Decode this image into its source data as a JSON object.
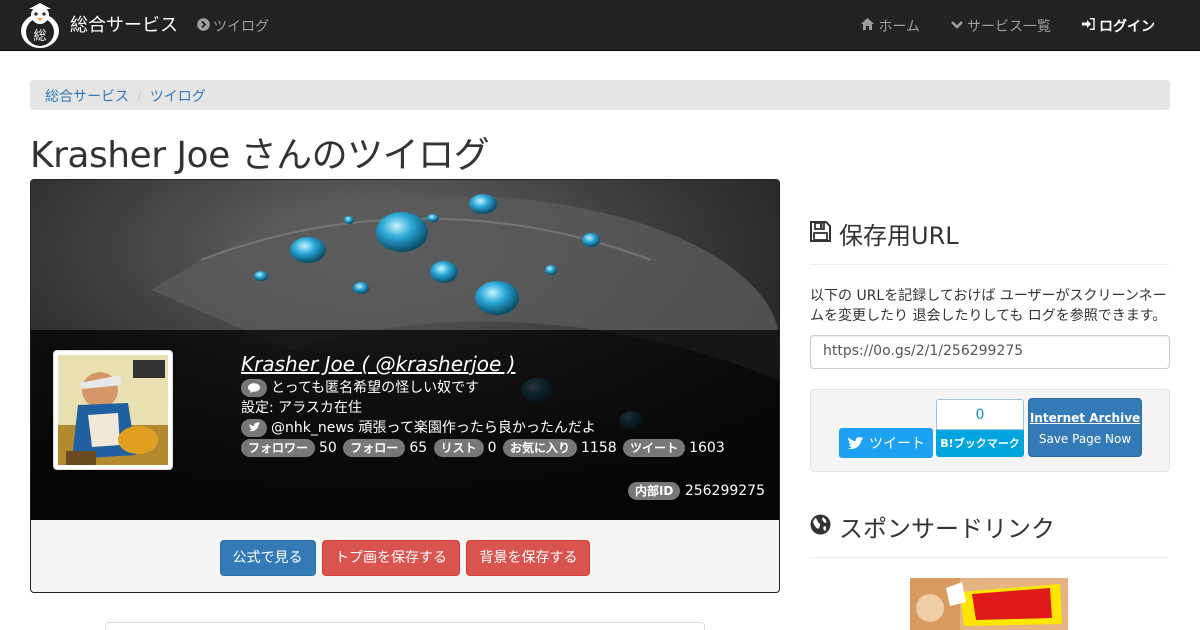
{
  "navbar": {
    "brand": "総合サービス",
    "brand_logo_glyph": "総",
    "section_link": "ツイログ",
    "items": [
      {
        "label": "ホーム",
        "icon": "home-icon"
      },
      {
        "label": "サービス一覧",
        "icon": "chevron-down-icon"
      },
      {
        "label": "ログイン",
        "icon": "sign-in-icon"
      }
    ]
  },
  "breadcrumb": [
    "総合サービス",
    "ツイログ"
  ],
  "page_title": "Krasher Joe さんのツイログ",
  "profile": {
    "name_line": "Krasher Joe ( @krasherjoe )",
    "bio": "とっても匿名希望の怪しい奴です",
    "location": "設定: アラスカ在住",
    "latest_tweet": "@nhk_news 頑張って楽園作ったら良かったんだよ",
    "stats": [
      {
        "label": "フォロワー",
        "value": "50"
      },
      {
        "label": "フォロー",
        "value": "65"
      },
      {
        "label": "リスト",
        "value": "0"
      },
      {
        "label": "お気に入り",
        "value": "1158"
      },
      {
        "label": "ツイート",
        "value": "1603"
      }
    ],
    "internal_id_label": "内部ID",
    "internal_id": "256299275",
    "buttons": {
      "official": "公式で見る",
      "save_icon": "トプ画を保存する",
      "save_bg": "背景を保存する"
    }
  },
  "sidebar": {
    "save_heading": "保存用URL",
    "save_desc": "以下の URLを記録しておけば ユーザーがスクリーンネームを変更したり 退会したりしても ログを参照できます。",
    "save_url": "https://0o.gs/2/1/256299275",
    "tweet_label": "ツイート",
    "hatena_count": "0",
    "hatena_label": "B!ブックマーク",
    "archive_title": "Internet Archive",
    "archive_sub": "Save Page Now",
    "sponsor_heading": "スポンサードリンク"
  },
  "colors": {
    "navbar_bg": "#222222",
    "link": "#337ab7",
    "primary": "#337ab7",
    "danger": "#d9534f",
    "twitter": "#1da1f2",
    "hatena": "#00a4de"
  }
}
